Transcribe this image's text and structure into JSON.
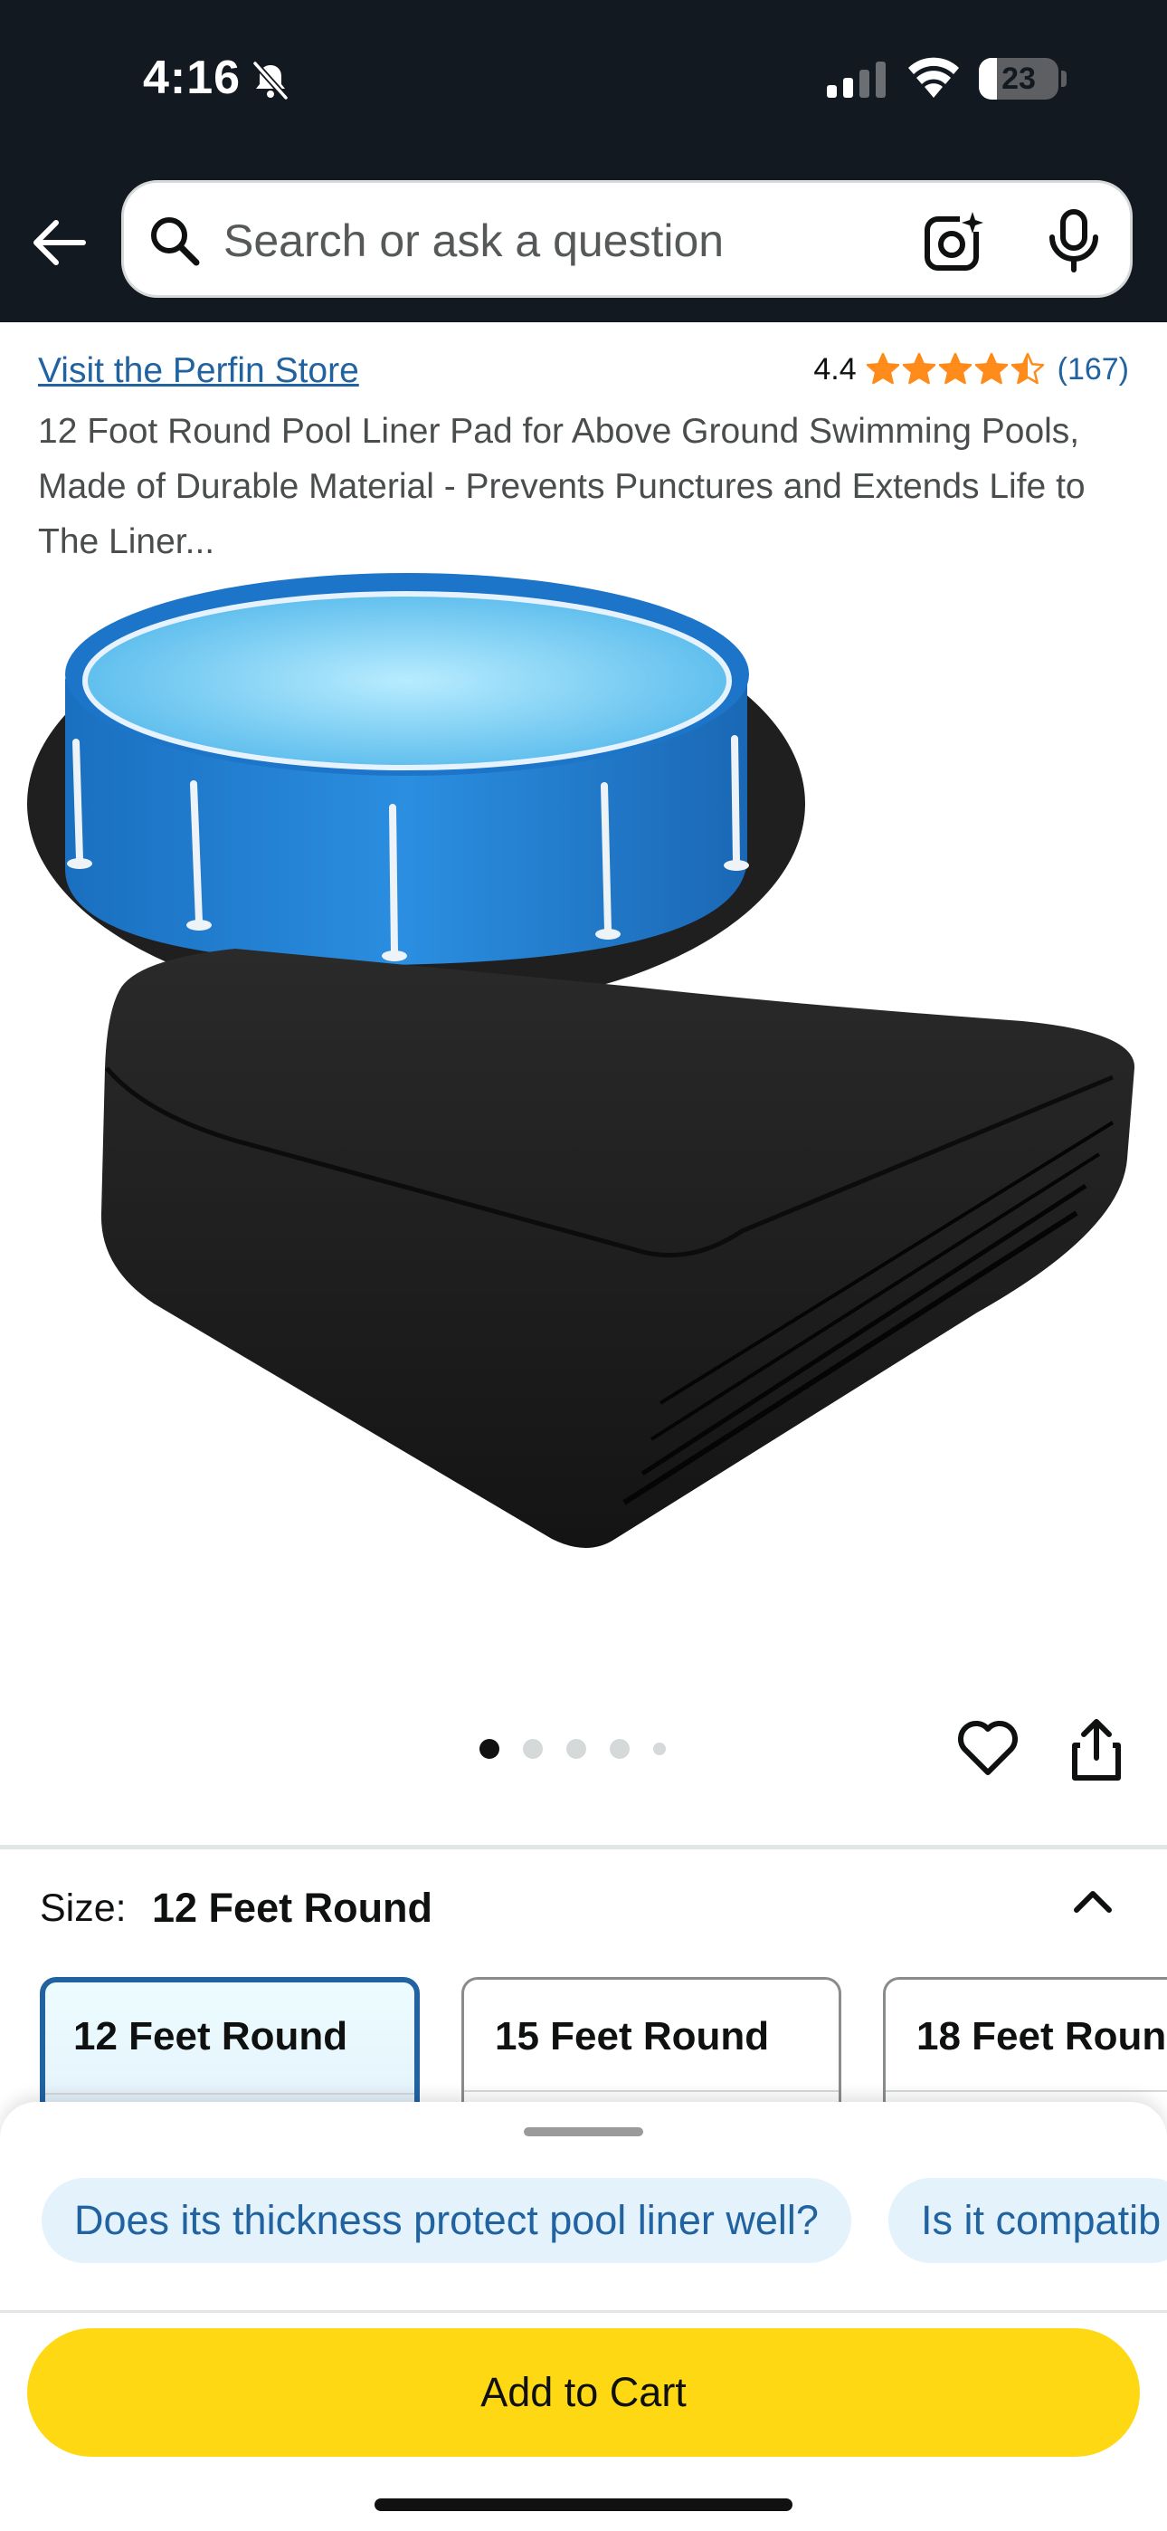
{
  "status_bar": {
    "time": "4:16",
    "battery_level": "23",
    "battery_fraction": 0.23,
    "icons": [
      "bell-slash-icon",
      "cellular-signal-icon",
      "wifi-icon",
      "battery-icon"
    ]
  },
  "header": {
    "back_icon": "arrow-left-icon",
    "search": {
      "placeholder": "Search or ask a question",
      "value": "",
      "icons": [
        "search-icon",
        "camera-lens-icon",
        "microphone-icon"
      ]
    }
  },
  "product": {
    "store_link": "Visit the Perfin Store",
    "rating_value": "4.4",
    "rating_stars": 4.5,
    "rating_count": "(167)",
    "title": "12 Foot Round Pool Liner Pad for Above Ground Swimming Pools, Made of Durable Material - Prevents Punctures and Extends Life to The Liner...",
    "image_alt": "pool-liner-pad-photo",
    "carousel": {
      "total": 5,
      "active": 0
    },
    "actions": [
      "heart-icon",
      "share-icon"
    ]
  },
  "size": {
    "label": "Size:",
    "selected": "12 Feet Round",
    "options": [
      "12 Feet Round",
      "15 Feet Round",
      "18 Feet Roun"
    ]
  },
  "sheet": {
    "chips": [
      "Does its thickness protect pool liner well?",
      "Is it compatib"
    ],
    "add_to_cart": "Add to Cart"
  },
  "colors": {
    "header_bg": "#131921",
    "link": "#2162a1",
    "star": "#ff8b1a",
    "cart_button": "#ffd814",
    "chip_bg": "#e3f2fb",
    "selected_border": "#2162a1"
  }
}
